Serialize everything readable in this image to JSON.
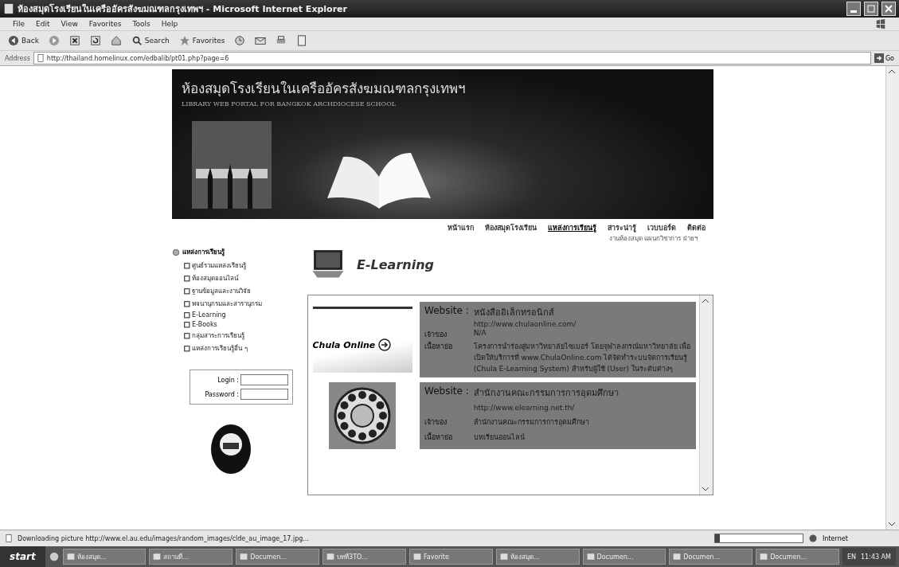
{
  "window": {
    "title": "ห้องสมุดโรงเรียนในเครืออัครสังฆมณฑลกรุงเทพฯ - Microsoft Internet Explorer"
  },
  "menu": [
    "File",
    "Edit",
    "View",
    "Favorites",
    "Tools",
    "Help"
  ],
  "toolbar": [
    {
      "kind": "back",
      "label": "Back"
    },
    {
      "kind": "forward"
    },
    {
      "kind": "stop"
    },
    {
      "kind": "refresh"
    },
    {
      "kind": "home"
    },
    {
      "kind": "search",
      "label": "Search"
    },
    {
      "kind": "favorites",
      "label": "Favorites"
    },
    {
      "kind": "history"
    },
    {
      "kind": "mail"
    },
    {
      "kind": "print"
    },
    {
      "kind": "edit"
    }
  ],
  "address": {
    "label": "Address",
    "value": "http://thailand.homelinux.com/edbalib/pt01.php?page=6",
    "go": "Go"
  },
  "banner": {
    "title": "ห้องสมุดโรงเรียนในเครืออัครสังฆมณฑลกรุงเทพฯ",
    "subtitle": "LIBRARY WEB PORTAL FOR BANGKOK ARCHDIOCESE SCHOOL"
  },
  "nav": [
    {
      "label": "หน้าแรก",
      "selected": false
    },
    {
      "label": "ห้องสมุดโรงเรียน",
      "selected": false
    },
    {
      "label": "แหล่งการเรียนรู้",
      "selected": true
    },
    {
      "label": "สาระน่ารู้",
      "selected": false
    },
    {
      "label": "เวบบอร์ด",
      "selected": false
    },
    {
      "label": "ติดต่อ",
      "selected": false
    }
  ],
  "dept_line": "งานห้องสมุด แผนกวิชาการ ฝ่ายฯ",
  "sidebar": {
    "heading": "แหล่งการเรียนรู้",
    "items": [
      "ศูนย์รวมแหล่งเรียนรู้",
      "ห้องสมุดออนไลน์",
      "ฐานข้อมูลและงานวิจัย",
      "พจนานุกรมและสารานุกรม",
      "E-Learning",
      "E-Books",
      "กลุ่มสาระการเรียนรู้",
      "แหล่งการเรียนรู้อื่น ๆ"
    ],
    "login_label": "Login :",
    "password_label": "Password :"
  },
  "section_title": "E-Learning",
  "resources": [
    {
      "logo_text": "Chula Online",
      "website_label": "Website :",
      "name": "หนังสืออิเล็กทรอนิกส์",
      "url": "http://www.chulaonline.com/",
      "owner_label": "เจ้าของ",
      "owner": "N/A",
      "summary_label": "เนื้อหาย่อ",
      "summary": "โครงการนำร่องสู่มหาวิทยาลัยไซเบอร์ โดยจุฬาลงกรณ์มหาวิทยาลัย เพื่อเปิดให้บริการที่ www.ChulaOnline.com ได้จัดทำระบบจัดการเรียนรู้ (Chula E-Learning System) สำหรับผู้ใช้ (User) ในระดับต่างๆ"
    },
    {
      "website_label": "Website :",
      "name": "สำนักงานคณะกรรมการการอุดมศึกษา",
      "url": "http://www.elearning.net.th/",
      "owner_label": "เจ้าของ",
      "owner": "สำนักงานคณะกรรมการการอุดมศึกษา",
      "summary_label": "เนื้อหาย่อ",
      "summary": "บทเรียนออนไลน์"
    }
  ],
  "status": {
    "text": "Downloading picture http://www.el.au.edu/images/random_images/clde_au_image_17.jpg...",
    "zone": "Internet",
    "progress": {
      "level": 0.05
    }
  },
  "taskbar": {
    "start": "start",
    "items": [
      "ห้องสมุด...",
      "สถานที่...",
      "Documen...",
      "บทที่3TO...",
      "Favorite",
      "ห้องสมุด...",
      "Documen...",
      "Documen...",
      "Documen..."
    ],
    "lang": "EN",
    "clock": "11:43 AM"
  }
}
